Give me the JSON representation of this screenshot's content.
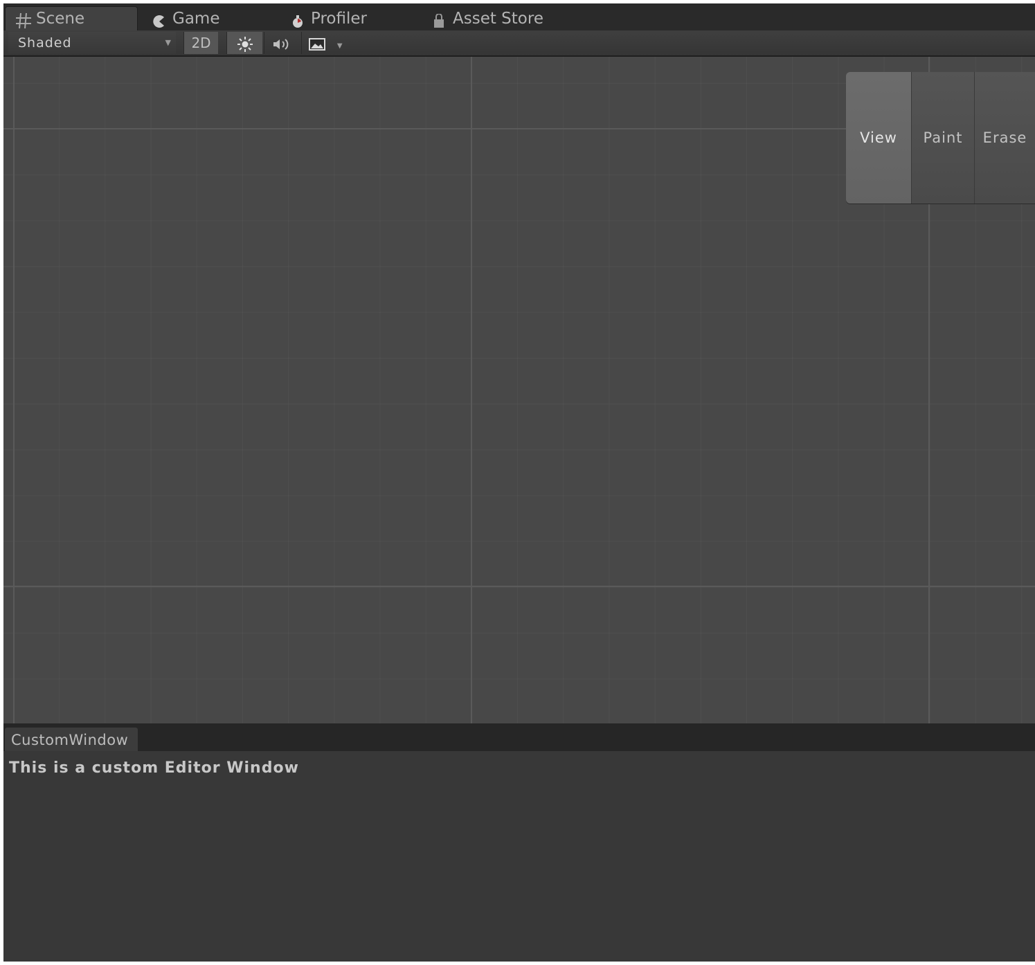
{
  "tabs": [
    {
      "label": "Scene",
      "icon": "scene-grid-icon",
      "active": true
    },
    {
      "label": "Game",
      "icon": "game-pacman-icon",
      "active": false
    },
    {
      "label": "Profiler",
      "icon": "profiler-icon",
      "active": false
    },
    {
      "label": "Asset Store",
      "icon": "asset-store-bag-icon",
      "active": false
    }
  ],
  "toolbar": {
    "shading_mode": "Shaded",
    "mode_2d_label": "2D",
    "lighting_icon": "sun-icon",
    "audio_icon": "speaker-icon",
    "effects_icon": "image-effects-icon"
  },
  "tool_panel": {
    "buttons": [
      {
        "label": "View",
        "selected": true
      },
      {
        "label": "Paint",
        "selected": false
      },
      {
        "label": "Erase",
        "selected": false
      }
    ]
  },
  "custom_window": {
    "tab_label": "CustomWindow",
    "message": "This is a custom Editor Window"
  },
  "colors": {
    "background": "#2b2b2b",
    "viewport": "#484848",
    "panel": "#383838"
  }
}
